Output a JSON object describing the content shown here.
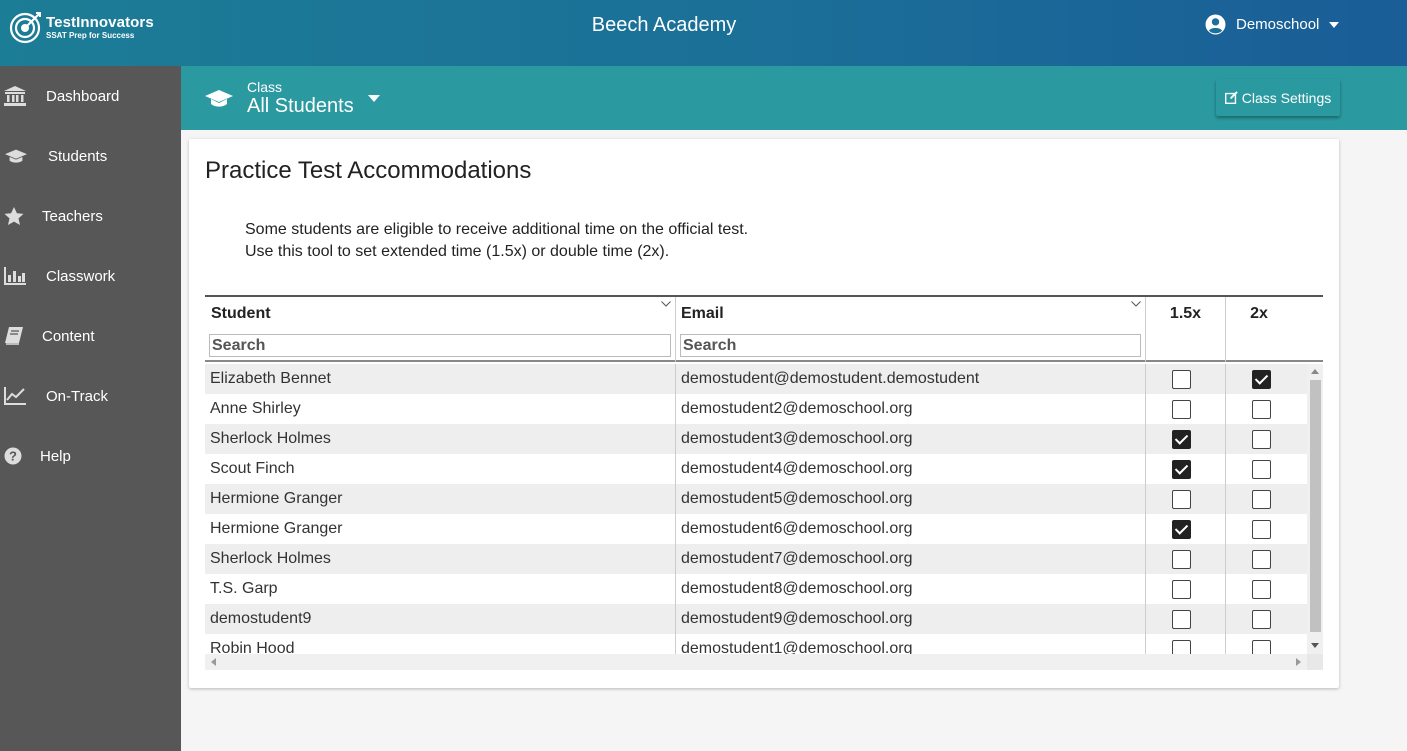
{
  "brand": {
    "name": "TestInnovators",
    "tagline": "SSAT Prep for Success"
  },
  "header": {
    "school": "Beech Academy",
    "user": "Demoschool"
  },
  "sidebar": {
    "items": [
      {
        "label": "Dashboard",
        "icon": "bank-icon"
      },
      {
        "label": "Students",
        "icon": "graduation-cap-icon"
      },
      {
        "label": "Teachers",
        "icon": "star-icon"
      },
      {
        "label": "Classwork",
        "icon": "bar-chart-icon"
      },
      {
        "label": "Content",
        "icon": "book-icon"
      },
      {
        "label": "On-Track",
        "icon": "line-chart-icon"
      },
      {
        "label": "Help",
        "icon": "question-icon"
      }
    ]
  },
  "classbar": {
    "caption": "Class",
    "selected": "All Students",
    "settings_label": "Class Settings"
  },
  "page": {
    "title": "Practice Test Accommodations",
    "desc_line1": "Some students are eligible to receive additional time on the official test.",
    "desc_line2": "Use this tool to set extended time (1.5x) or double time (2x)."
  },
  "table": {
    "columns": {
      "student": "Student",
      "email": "Email",
      "x15": "1.5x",
      "x2": "2x"
    },
    "search_placeholder": "Search",
    "rows": [
      {
        "student": "Elizabeth Bennet",
        "email": "demostudent@demostudent.demostudent",
        "x15": false,
        "x2": true
      },
      {
        "student": "Anne Shirley",
        "email": "demostudent2@demoschool.org",
        "x15": false,
        "x2": false
      },
      {
        "student": "Sherlock Holmes",
        "email": "demostudent3@demoschool.org",
        "x15": true,
        "x2": false
      },
      {
        "student": "Scout Finch",
        "email": "demostudent4@demoschool.org",
        "x15": true,
        "x2": false
      },
      {
        "student": "Hermione Granger",
        "email": "demostudent5@demoschool.org",
        "x15": false,
        "x2": false
      },
      {
        "student": "Hermione Granger",
        "email": "demostudent6@demoschool.org",
        "x15": true,
        "x2": false
      },
      {
        "student": "Sherlock Holmes",
        "email": "demostudent7@demoschool.org",
        "x15": false,
        "x2": false
      },
      {
        "student": "T.S. Garp",
        "email": "demostudent8@demoschool.org",
        "x15": false,
        "x2": false
      },
      {
        "student": "demostudent9",
        "email": "demostudent9@demoschool.org",
        "x15": false,
        "x2": false
      },
      {
        "student": "Robin Hood",
        "email": "demostudent1@demoschool.org",
        "x15": false,
        "x2": false
      }
    ]
  }
}
